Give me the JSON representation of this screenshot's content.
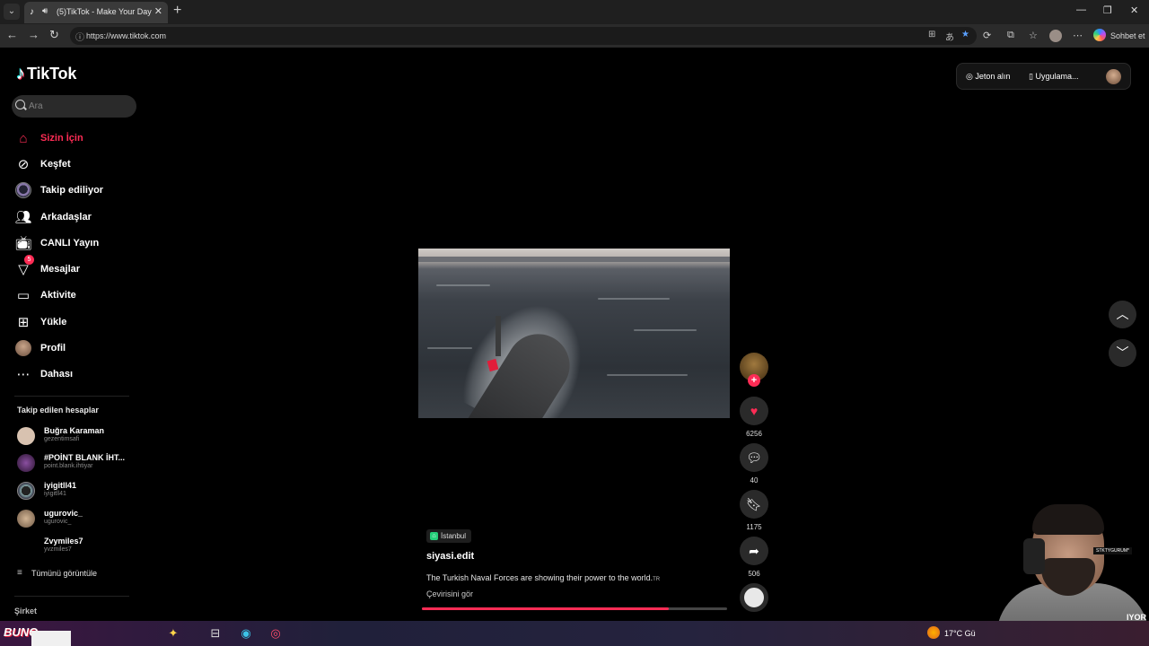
{
  "browser": {
    "tab_title": "(5)TikTok - Make Your Day",
    "tab_favicon": "tiktok-icon",
    "url": "https://www.tiktok.com",
    "copilot_label": "Sohbet et"
  },
  "tiktok": {
    "logo_text": "TikTok",
    "search_placeholder": "Ara",
    "nav": [
      {
        "label": "Sizin İçin",
        "icon": "home-icon",
        "active": true
      },
      {
        "label": "Keşfet",
        "icon": "compass-icon"
      },
      {
        "label": "Takip ediliyor",
        "icon": "following-avatar"
      },
      {
        "label": "Arkadaşlar",
        "icon": "friends-icon"
      },
      {
        "label": "CANLI Yayın",
        "icon": "live-icon"
      },
      {
        "label": "Mesajlar",
        "icon": "messages-icon",
        "badge": "5"
      },
      {
        "label": "Aktivite",
        "icon": "activity-icon"
      },
      {
        "label": "Yükle",
        "icon": "upload-icon"
      },
      {
        "label": "Profil",
        "icon": "profile-avatar"
      },
      {
        "label": "Dahası",
        "icon": "more-icon"
      }
    ],
    "following_title": "Takip edilen hesaplar",
    "following": [
      {
        "name": "Buğra Karaman",
        "user": "gezentimsafi",
        "color": "#d8c2b0"
      },
      {
        "name": "#POİNT BLANK İHT...",
        "user": "point.blank.ihtiyar",
        "color": "#5a2f6a"
      },
      {
        "name": "iyigitll41",
        "user": "iyigitll41",
        "color": "#3a4a6a"
      },
      {
        "name": "ugurovic_",
        "user": "ugurovic_",
        "color": "#c6a98e"
      },
      {
        "name": "Zvymiles7",
        "user": "yvzmiles7",
        "color": "#000000"
      }
    ],
    "see_all": "Tümünü görüntüle",
    "footer_heading": "Şirket",
    "top_right": {
      "coins": "Jeton alın",
      "app": "Uygulama..."
    },
    "video": {
      "location": "İstanbul",
      "author": "siyasi.edit",
      "caption": "The Turkish Naval Forces are showing their power to the world.",
      "caption_lang": "TR",
      "translate": "Çevirisini gör",
      "progress": 0.81
    },
    "actions": {
      "likes": "6256",
      "comments": "40",
      "saves": "1175",
      "shares": "506"
    }
  },
  "overlay": {
    "cam_tag": "STKTYGURUM*",
    "cam_side_text": "IYOR"
  },
  "taskbar": {
    "logo": "BUNO",
    "weather": "17°C Gü"
  }
}
